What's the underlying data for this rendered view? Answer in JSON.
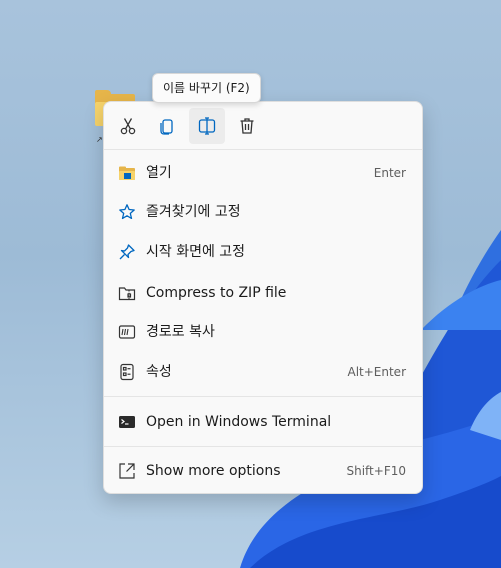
{
  "desktop": {
    "folder_icon": "folder-icon",
    "shortcut_icon": "shortcut-arrow-icon"
  },
  "tooltip": {
    "text": "이름 바꾸기 (F2)"
  },
  "toolbar": {
    "buttons": [
      {
        "name": "cut",
        "icon": "scissors-icon"
      },
      {
        "name": "copy",
        "icon": "copy-icon"
      },
      {
        "name": "rename",
        "icon": "rename-icon",
        "hovered": true
      },
      {
        "name": "delete",
        "icon": "trash-icon"
      }
    ]
  },
  "menu": {
    "items": [
      {
        "label": "열기",
        "shortcut": "Enter",
        "icon": "folder-open-icon"
      },
      {
        "label": "즐겨찾기에 고정",
        "shortcut": "",
        "icon": "star-icon"
      },
      {
        "label": "시작 화면에 고정",
        "shortcut": "",
        "icon": "pin-icon"
      },
      {
        "label": "Compress to ZIP file",
        "shortcut": "",
        "icon": "zip-icon"
      },
      {
        "label": "경로로 복사",
        "shortcut": "",
        "icon": "copy-path-icon"
      },
      {
        "label": "속성",
        "shortcut": "Alt+Enter",
        "icon": "properties-icon"
      },
      {
        "label": "Open in Windows Terminal",
        "shortcut": "",
        "icon": "terminal-icon"
      },
      {
        "label": "Show more options",
        "shortcut": "Shift+F10",
        "icon": "show-more-icon"
      }
    ]
  },
  "colors": {
    "accent": "#0067c0",
    "menu_bg": "#f9f9f9",
    "wallpaper": "#a8c3dc"
  }
}
